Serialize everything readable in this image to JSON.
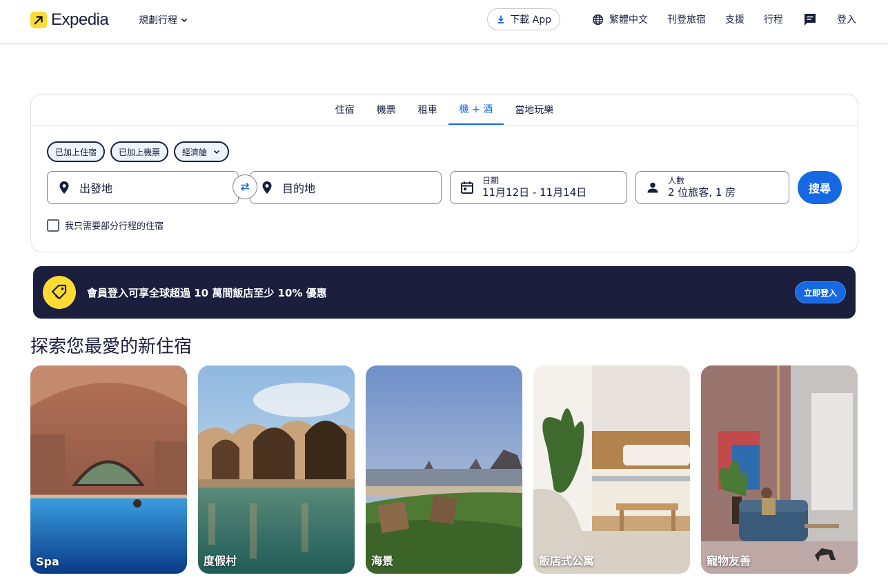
{
  "header": {
    "logo_text": "Expedia",
    "plan_trip": "規劃行程",
    "download_app": "下載 App",
    "language": "繁體中文",
    "list_property": "刊登旅宿",
    "support": "支援",
    "trips": "行程",
    "sign_in": "登入"
  },
  "search": {
    "tabs": [
      {
        "label": "住宿"
      },
      {
        "label": "機票"
      },
      {
        "label": "租車"
      },
      {
        "label": "機 + 酒"
      },
      {
        "label": "當地玩樂"
      }
    ],
    "active_tab": "機 + 酒",
    "chips": {
      "stay_added": "已加上住宿",
      "flight_added": "已加上機票",
      "cabin_class": "經濟艙"
    },
    "origin_placeholder": "出發地",
    "destination_placeholder": "目的地",
    "dates_label": "日期",
    "dates_value": "11月12日 - 11月14日",
    "travelers_label": "人數",
    "travelers_value": "2 位旅客, 1 房",
    "search_button": "搜尋",
    "partial_stay_checkbox": "我只需要部分行程的住宿",
    "partial_stay_checked": false
  },
  "banner": {
    "text": "會員登入可享全球超過 10 萬間飯店至少 10% 優惠",
    "button": "立即登入"
  },
  "explore": {
    "title": "探索您最愛的新住宿",
    "cards": [
      {
        "label": "Spa"
      },
      {
        "label": "度假村"
      },
      {
        "label": "海景"
      },
      {
        "label": "飯店式公寓"
      },
      {
        "label": "寵物友善"
      }
    ]
  },
  "colors": {
    "primary_blue": "#1668e3",
    "navy": "#1b1e3d",
    "brand_yellow": "#fddb32",
    "text_dark": "#191e3b"
  },
  "icons": {
    "logo": "expedia-arrow-icon",
    "download": "download-icon",
    "language": "globe-icon",
    "messages": "chat-icon",
    "location": "map-pin-icon",
    "swap": "swap-arrows-icon",
    "calendar": "calendar-icon",
    "person": "person-icon",
    "tag": "price-tag-icon"
  }
}
